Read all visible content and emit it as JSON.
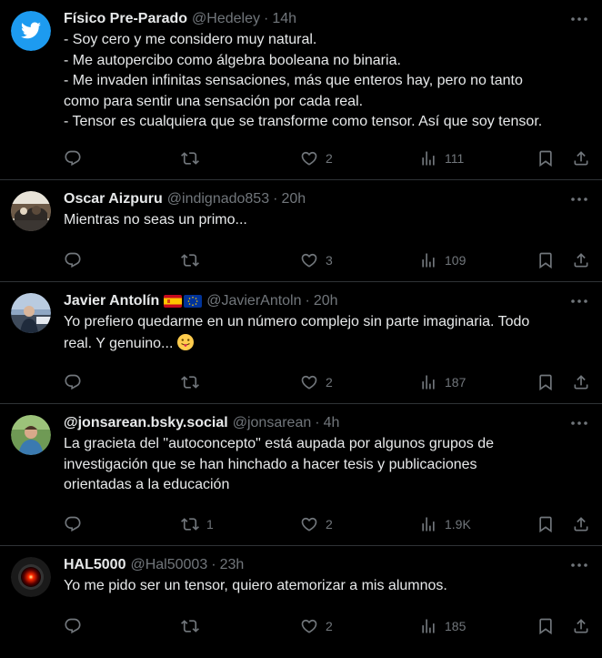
{
  "tweets": [
    {
      "name": "Físico Pre-Parado",
      "handle": "@Hedeley",
      "sep": "·",
      "time": "14h",
      "lines": [
        "- Soy cero y me considero muy natural.",
        "- Me autopercibo como álgebra booleana no binaria.",
        "- Me invaden infinitas sensaciones, más que enteros hay, pero no tanto",
        "como para sentir una sensación por cada real.",
        "- Tensor es cualquiera que se transforme como tensor. Así que soy tensor."
      ],
      "replies": "",
      "retweets": "",
      "likes": "2",
      "views": "111"
    },
    {
      "name": "Oscar Aizpuru",
      "handle": "@indignado853",
      "sep": "·",
      "time": "20h",
      "lines": [
        "Mientras no seas un primo..."
      ],
      "replies": "",
      "retweets": "",
      "likes": "3",
      "views": "109"
    },
    {
      "name": "Javier Antolín",
      "handle": "@JavierAntoln",
      "sep": "·",
      "time": "20h",
      "lines": [
        "Yo prefiero quedarme en un número complejo sin parte imaginaria. Todo",
        "real. Y genuino..."
      ],
      "replies": "",
      "retweets": "",
      "likes": "2",
      "views": "187"
    },
    {
      "name": "@jonsarean.bsky.social",
      "handle": "@jonsarean",
      "sep": "·",
      "time": "4h",
      "lines": [
        "La gracieta del \"autoconcepto\" está aupada por algunos grupos de",
        "investigación que se han hinchado a hacer tesis y publicaciones",
        "orientadas a la educación"
      ],
      "replies": "",
      "retweets": "1",
      "likes": "2",
      "views": "1.9K"
    },
    {
      "name": "HAL5000",
      "handle": "@Hal50003",
      "sep": "·",
      "time": "23h",
      "lines": [
        "Yo me pido ser un tensor, quiero atemorizar a mis alumnos."
      ],
      "replies": "",
      "retweets": "",
      "likes": "2",
      "views": "185"
    }
  ],
  "colors": {
    "background": "#000000",
    "text": "#e7e9ea",
    "muted": "#71767b",
    "divider": "#2f3336",
    "twitter_blue": "#1d9bf0"
  },
  "icons": {
    "reply": "reply-icon",
    "retweet": "retweet-icon",
    "like": "heart-icon",
    "views": "views-icon",
    "bookmark": "bookmark-icon",
    "share": "share-icon",
    "more": "more-icon"
  }
}
